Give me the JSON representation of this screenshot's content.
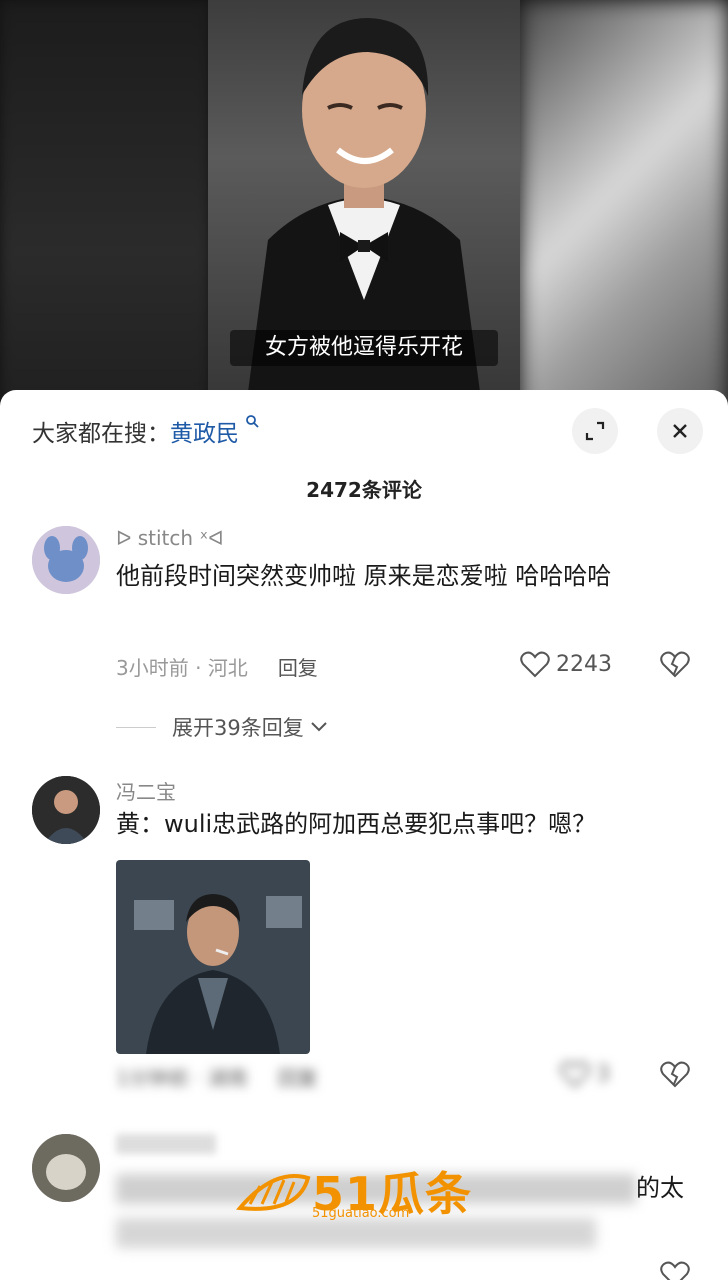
{
  "video": {
    "subtitle": "女方被他逗得乐开花"
  },
  "sheet": {
    "search_prefix": "大家都在搜：",
    "search_keyword": "黄政民",
    "comment_count": "2472条评论"
  },
  "comments": [
    {
      "username": "ᐅ stitch ˣᐊ",
      "text": "他前段时间突然变帅啦  原来是恋爱啦 哈哈哈哈",
      "time": "3小时前",
      "location": "河北",
      "reply_label": "回复",
      "likes": "2243",
      "expand_replies": "展开39条回复"
    },
    {
      "username": "冯二宝",
      "text": "黄：wuli忠武路的阿加西总要犯点事吧？嗯？",
      "time": "1分钟前",
      "location": "湖南",
      "reply_label": "回复",
      "likes": "3"
    },
    {
      "text_visible_end": "的太"
    }
  ],
  "watermark": {
    "logo": "51瓜条",
    "url": "51guatiao.com"
  },
  "colors": {
    "keyword": "#1f5aa6",
    "watermark": "#f39200"
  }
}
